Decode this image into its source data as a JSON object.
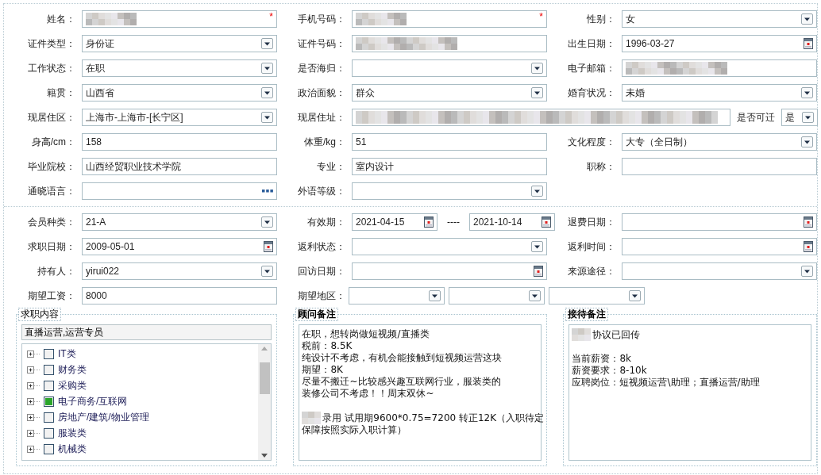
{
  "sections": [
    {
      "rows": [
        [
          {
            "label": "姓名：",
            "kind": "text",
            "redacted": true,
            "required_mark": "*"
          },
          {
            "label": "手机号码：",
            "kind": "text",
            "redacted": true,
            "required_mark": "*"
          },
          {
            "label": "性别：",
            "kind": "select",
            "value": "女"
          }
        ],
        [
          {
            "label": "证件类型：",
            "kind": "select",
            "value": "身份证"
          },
          {
            "label": "证件号码：",
            "kind": "text",
            "redacted": true
          },
          {
            "label": "出生日期：",
            "kind": "date",
            "value": "1996-03-27"
          }
        ],
        [
          {
            "label": "工作状态：",
            "kind": "select",
            "value": "在职"
          },
          {
            "label": "是否海归：",
            "kind": "select"
          },
          {
            "label": "电子邮箱：",
            "kind": "text",
            "redacted": true
          }
        ],
        [
          {
            "label": "籍贯：",
            "kind": "select",
            "value": "山西省"
          },
          {
            "label": "政治面貌：",
            "kind": "select",
            "value": "群众"
          },
          {
            "label": "婚育状况：",
            "kind": "select",
            "value": "未婚"
          }
        ],
        [
          {
            "label": "现居住区：",
            "kind": "select",
            "value": "上海市-上海市-[长宁区]"
          },
          {
            "label": "现居住址：",
            "kind": "text",
            "redacted": true
          },
          {
            "label": "是否可迁",
            "kind": "inline-select",
            "value": "是"
          }
        ],
        [
          {
            "label": "身高/cm：",
            "kind": "text",
            "value": "158"
          },
          {
            "label": "体重/kg：",
            "kind": "text",
            "value": "51"
          },
          {
            "label": "文化程度：",
            "kind": "select",
            "value": "大专（全日制）"
          }
        ],
        [
          {
            "label": "毕业院校：",
            "kind": "text",
            "value": "山西经贸职业技术学院"
          },
          {
            "label": "专业：",
            "kind": "text",
            "value": "室内设计"
          },
          {
            "label": "职称：",
            "kind": "text"
          }
        ],
        [
          {
            "label": "通晓语言：",
            "kind": "more"
          },
          {
            "label": "外语等级：",
            "kind": "select"
          }
        ]
      ]
    },
    {
      "rows": [
        [
          {
            "label": "会员种类：",
            "kind": "select",
            "value": "21-A"
          },
          {
            "label": "有效期：",
            "kind": "daterange",
            "values": [
              "2021-04-15",
              "2021-10-14"
            ],
            "separator": "----"
          },
          {
            "label": "退费日期：",
            "kind": "date"
          }
        ],
        [
          {
            "label": "求职日期：",
            "kind": "date",
            "value": "2009-05-01"
          },
          {
            "label": "返利状态：",
            "kind": "select"
          },
          {
            "label": "返利时间：",
            "kind": "date"
          }
        ],
        [
          {
            "label": "持有人：",
            "kind": "select",
            "value": "yirui022"
          },
          {
            "label": "回访日期：",
            "kind": "date"
          },
          {
            "label": "来源途径：",
            "kind": "select"
          }
        ],
        [
          {
            "label": "期望工资：",
            "kind": "text",
            "value": "8000"
          },
          {
            "label": "期望地区：",
            "kind": "region",
            "parts": [
              {
                "kind": "select"
              },
              {
                "kind": "select"
              },
              {
                "kind": "select"
              }
            ]
          }
        ]
      ]
    }
  ],
  "panels": [
    {
      "kind": "tree",
      "legend": "求职内容",
      "bold": false,
      "summary": "直播运营,运营专员",
      "items": [
        {
          "label": "IT类",
          "checked": false
        },
        {
          "label": "财务类",
          "checked": false
        },
        {
          "label": "采购类",
          "checked": false
        },
        {
          "label": "电子商务/互联网",
          "checked": true
        },
        {
          "label": "房地产/建筑/物业管理",
          "checked": false
        },
        {
          "label": "服装类",
          "checked": false
        },
        {
          "label": "机械类",
          "checked": false
        }
      ]
    },
    {
      "kind": "notes",
      "legend": "顾问备注",
      "bold": true,
      "paragraphs": [
        [
          {
            "text": "在职，想转岗做短视频/直播类"
          },
          {
            "text": "税前：8.5K"
          },
          {
            "text": "纯设计不考虑，有机会能接触到短视频运营这块"
          },
          {
            "text": "期望：8K"
          },
          {
            "text": "尽量不搬迁~比较感兴趣互联网行业，服装类的"
          },
          {
            "text": "装修公司不考虑！！周末双休~"
          }
        ],
        [
          {
            "text": "录用 试用期9600*0.75=7200 转正12K（入职待定",
            "redacted": true
          },
          {
            "text": "保障按照实际入职计算）"
          }
        ]
      ]
    },
    {
      "kind": "notes",
      "legend": "接待备注",
      "bold": true,
      "paragraphs": [
        [
          {
            "text": "协议已回传",
            "redacted": true
          }
        ],
        [
          {
            "text": "当前薪资：8k"
          },
          {
            "text": "薪资要求：8-10k"
          },
          {
            "text": "应聘岗位：短视频运营\\助理；直播运营/助理"
          }
        ]
      ]
    }
  ]
}
